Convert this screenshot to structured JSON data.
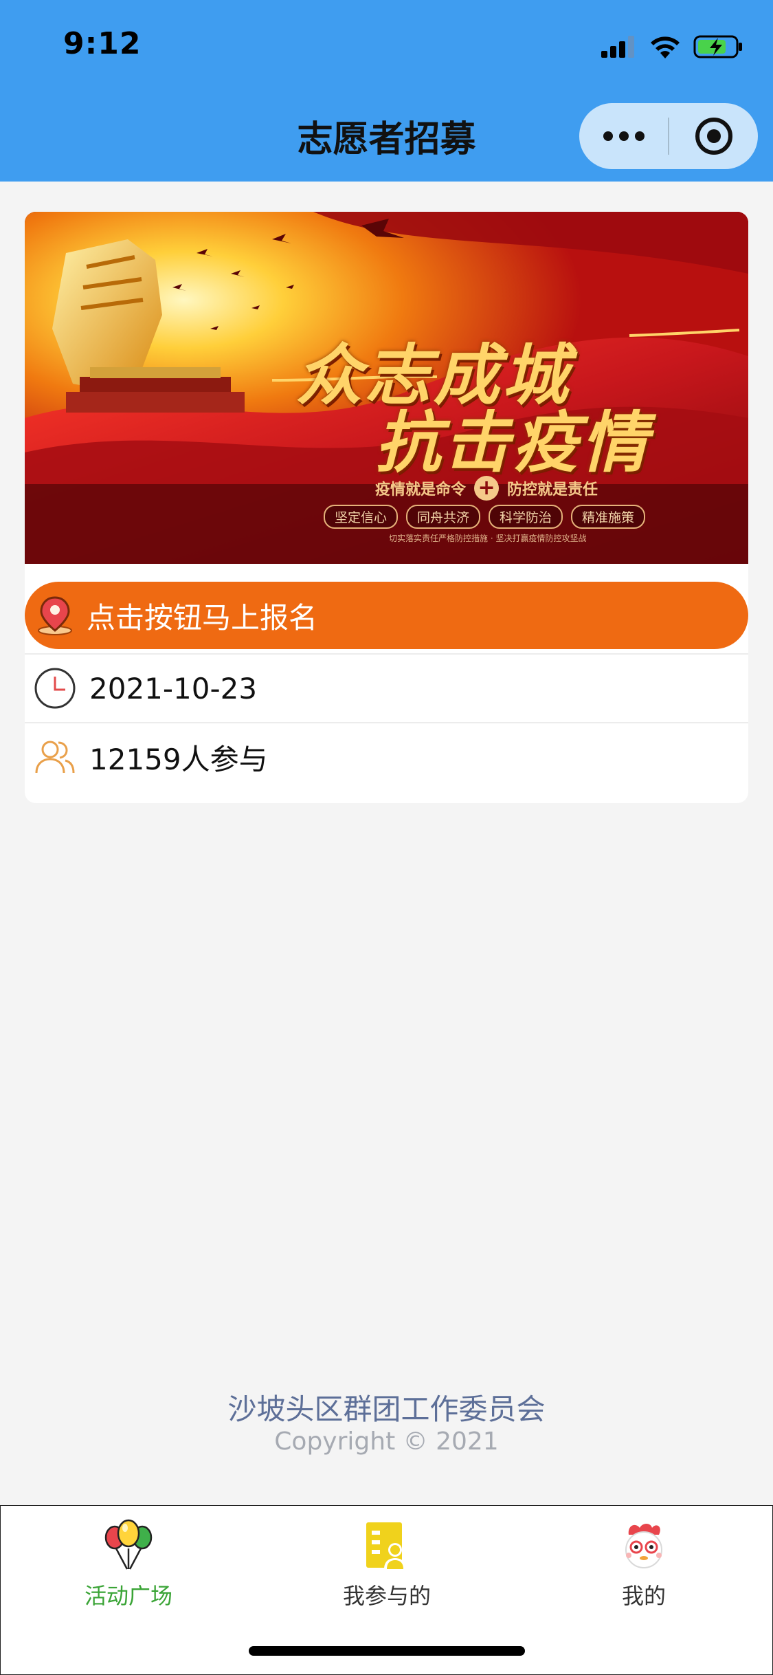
{
  "status_bar": {
    "time": "9:12"
  },
  "nav": {
    "title": "志愿者招募",
    "more_icon": "more-dots-icon",
    "close_icon": "target-circle-icon"
  },
  "banner": {
    "title_line1": "众志成城",
    "title_line2": "抗击疫情",
    "slogan_left": "疫情就是命令",
    "slogan_right": "防控就是责任",
    "tags": [
      "坚定信心",
      "同舟共济",
      "科学防治",
      "精准施策"
    ],
    "footer_text": "切实落实责任严格防控措施 · 坚决打赢疫情防控攻坚战",
    "colors": {
      "deep_red": "#7a0508",
      "red": "#c8171c",
      "gold": "#ffd469"
    }
  },
  "signup": {
    "label": "点击按钮马上报名",
    "icon": "location-pin-icon",
    "color": "#ef6a12"
  },
  "event": {
    "date": "2021-10-23",
    "participants": "12159人参与",
    "date_icon": "clock-icon",
    "people_icon": "users-icon"
  },
  "footer": {
    "org_name": "沙坡头区群团工作委员会",
    "copyright": "Copyright © 2021"
  },
  "tabs": [
    {
      "label": "活动广场",
      "icon": "balloons-icon",
      "active": true
    },
    {
      "label": "我参与的",
      "icon": "document-user-icon",
      "active": false
    },
    {
      "label": "我的",
      "icon": "cartoon-face-icon",
      "active": false
    }
  ],
  "colors": {
    "header_blue": "#3f9df0",
    "active_tab_green": "#3aa436",
    "org_text": "#5d6f98"
  }
}
